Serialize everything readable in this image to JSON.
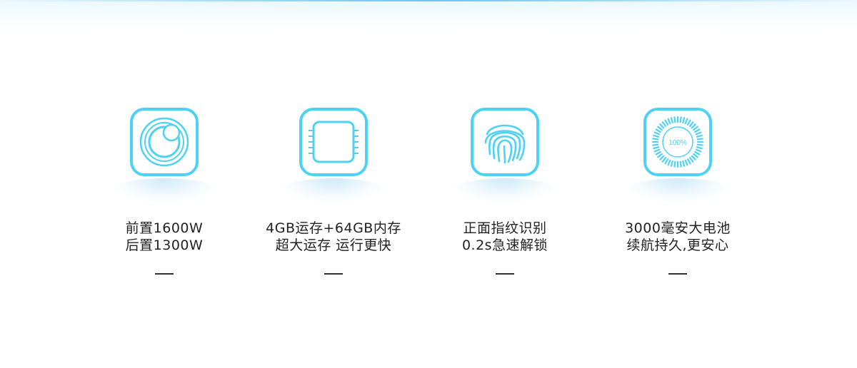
{
  "colors": {
    "accent": "#4dd2f5",
    "text": "#222222",
    "dash": "#333333"
  },
  "features": [
    {
      "icon": "camera-icon",
      "line1": "前置1600W",
      "line2": "后置1300W"
    },
    {
      "icon": "chip-icon",
      "line1": "4GB运存+64GB内存",
      "line2": "超大运存 运行更快"
    },
    {
      "icon": "fingerprint-icon",
      "line1": "正面指纹识别",
      "line2": "0.2s急速解锁"
    },
    {
      "icon": "battery-icon",
      "line1": "3000毫安大电池",
      "line2": "续航持久,更安心",
      "battery_label": "100%"
    }
  ]
}
